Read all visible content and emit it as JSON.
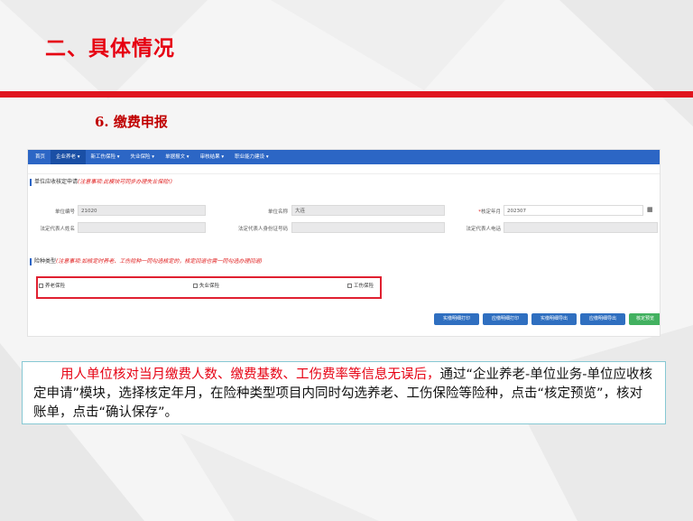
{
  "slide": {
    "title": "二、具体情况",
    "subtitle": "6. 缴费申报"
  },
  "nav": {
    "items": [
      {
        "label": "首页"
      },
      {
        "label": "企业养老 ▾"
      },
      {
        "label": "新工伤保险 ▾"
      },
      {
        "label": "失业保险 ▾"
      },
      {
        "label": "单据报文 ▾"
      },
      {
        "label": "审核结果 ▾"
      },
      {
        "label": "职业能力建设 ▾"
      }
    ]
  },
  "section1": {
    "title": "单位应收核定申请",
    "note": "(注意事项:此模块可同步办理失业保险!)"
  },
  "form": {
    "unit_no_label": "单位编号",
    "unit_no_value": "21020",
    "unit_name_label": "单位名称",
    "unit_name_value": "大连",
    "month_label": "核定年月",
    "month_value": "202307",
    "legal_name_label": "法定代表人姓名",
    "legal_id_label": "法定代表人身份证号码",
    "legal_phone_label": "法定代表人电话"
  },
  "section2": {
    "title": "险种类型",
    "note": "(注意事项:如核定时养老、工伤险种一同勾选核定的，核定回退也需一同勾选办理回退)"
  },
  "insurance_types": [
    {
      "label": "养老保险"
    },
    {
      "label": "失业保险"
    },
    {
      "label": "工伤保险"
    }
  ],
  "buttons": {
    "btn1": "实缴明细打印",
    "btn2": "应缴明细打印",
    "btn3": "实缴明细导出",
    "btn4": "应缴明细导出",
    "btn5": "核定预览"
  },
  "description": {
    "red_part": "用人单位核对当月缴费人数、缴费基数、工伤费率等信息无误后，",
    "black_part": "通过“企业养老-单位业务-单位应收核定申请”模块，选择核定年月，在险种类型项目内同时勾选养老、工伤保险等险种，点击“核定预览”，核对账单，点击“确认保存”。"
  },
  "colors": {
    "accent_red": "#e60012",
    "nav_blue": "#2c66c5",
    "button_green": "#42b160"
  }
}
